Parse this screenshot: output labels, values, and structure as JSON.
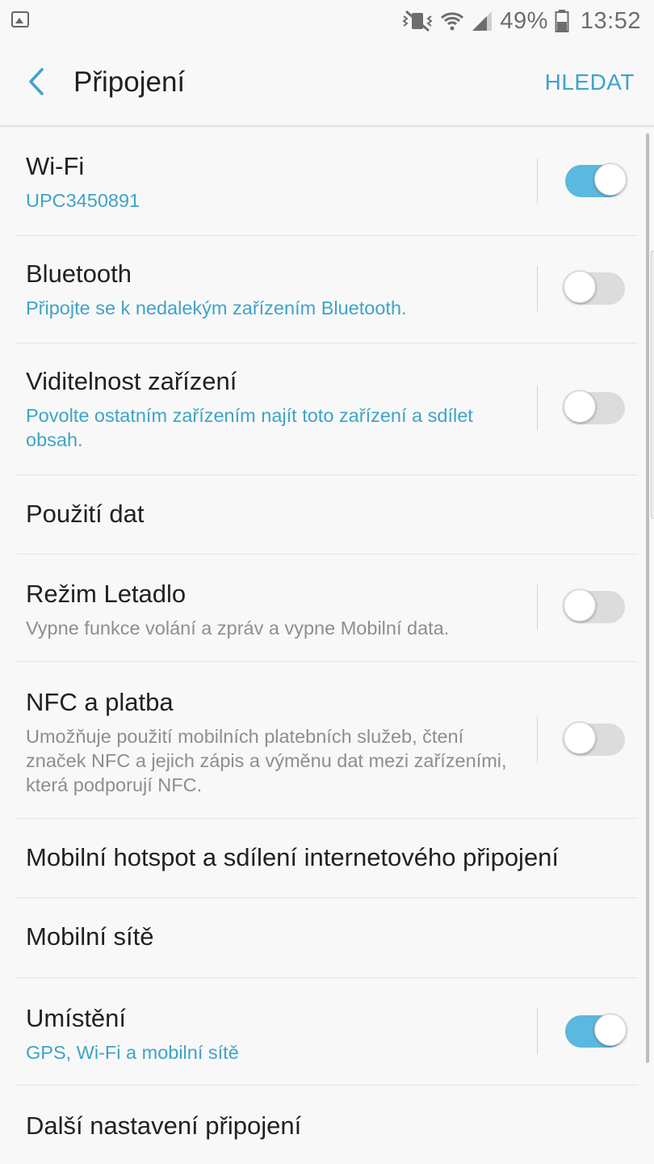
{
  "status_bar": {
    "battery_percent": "49%",
    "time": "13:52",
    "icons": [
      "gallery-icon",
      "vibrate-off-icon",
      "wifi-icon",
      "signal-icon",
      "battery-icon"
    ]
  },
  "header": {
    "title": "Připojení",
    "search_label": "HLEDAT",
    "back_icon": "chevron-left-icon"
  },
  "colors": {
    "accent": "#3fa3c8",
    "toggle_on": "#5bb8df",
    "background": "#f8f8f8"
  },
  "settings": [
    {
      "title": "Wi-Fi",
      "subtitle": "UPC3450891",
      "subtitle_style": "accent",
      "toggle": true
    },
    {
      "title": "Bluetooth",
      "subtitle": "Připojte se k nedalekým zařízením Bluetooth.",
      "subtitle_style": "accent",
      "toggle": false
    },
    {
      "title": "Viditelnost zařízení",
      "subtitle": "Povolte ostatním zařízením najít toto zařízení a sdílet obsah.",
      "subtitle_style": "accent",
      "toggle": false
    },
    {
      "title": "Použití dat"
    },
    {
      "title": "Režim Letadlo",
      "subtitle": "Vypne funkce volání a zpráv a vypne Mobilní data.",
      "subtitle_style": "gray",
      "toggle": false
    },
    {
      "title": "NFC a platba",
      "subtitle": "Umožňuje použití mobilních platebních služeb, čtení značek NFC a jejich zápis a výměnu dat mezi zařízeními, která podporují NFC.",
      "subtitle_style": "gray",
      "toggle": false
    },
    {
      "title": "Mobilní hotspot a sdílení internetového připojení"
    },
    {
      "title": "Mobilní sítě"
    },
    {
      "title": "Umístění",
      "subtitle": "GPS, Wi-Fi a mobilní sítě",
      "subtitle_style": "accent",
      "toggle": true
    },
    {
      "title": "Další nastavení připojení"
    }
  ]
}
